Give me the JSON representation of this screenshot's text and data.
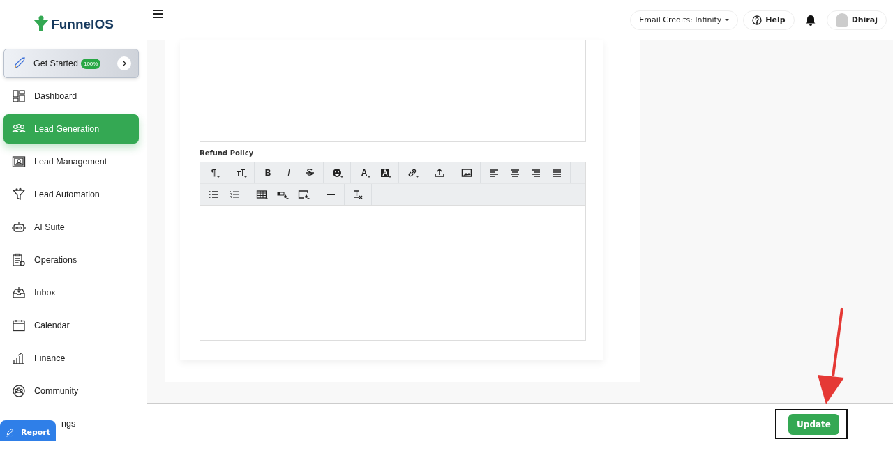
{
  "logo": {
    "text": "FunnelOS"
  },
  "get_started": {
    "label": "Get Started",
    "badge": "100%"
  },
  "sidebar": {
    "items": [
      {
        "label": "Dashboard",
        "kind": "dashboard",
        "selected": false
      },
      {
        "label": "Lead Generation",
        "kind": "people",
        "selected": true
      },
      {
        "label": "Lead Management",
        "kind": "contact",
        "selected": false
      },
      {
        "label": "Lead Automation",
        "kind": "funnel",
        "selected": false
      },
      {
        "label": "AI Suite",
        "kind": "robot",
        "selected": false
      },
      {
        "label": "Operations",
        "kind": "clipboard",
        "selected": false
      },
      {
        "label": "Inbox",
        "kind": "inbox",
        "selected": false
      },
      {
        "label": "Calendar",
        "kind": "calendar",
        "selected": false
      },
      {
        "label": "Finance",
        "kind": "chart",
        "selected": false
      },
      {
        "label": "Community",
        "kind": "community",
        "selected": false
      },
      {
        "label": "ngs",
        "kind": "hidden",
        "selected": false
      }
    ]
  },
  "report": {
    "label": "Report"
  },
  "header": {
    "credits": "Email Credits: Infinity",
    "help": "Help",
    "user": "Dhiraj"
  },
  "editor": {
    "label": "Refund Policy",
    "toolbar": [
      [
        [
          {
            "kind": "glyph",
            "glyph": "¶",
            "dropdown": true
          }
        ],
        [
          {
            "kind": "text-size",
            "dropdown": true
          }
        ],
        [
          {
            "kind": "glyph",
            "glyph": "B",
            "dropdown": false
          },
          {
            "kind": "glyph",
            "glyph": "I",
            "dropdown": false
          },
          {
            "kind": "strike",
            "dropdown": false
          }
        ],
        [
          {
            "kind": "emoji",
            "dropdown": true
          }
        ],
        [
          {
            "kind": "glyph",
            "glyph": "A",
            "dropdown": true
          },
          {
            "kind": "highlight",
            "dropdown": true
          }
        ],
        [
          {
            "kind": "link",
            "dropdown": true
          }
        ],
        [
          {
            "kind": "upload",
            "dropdown": false
          }
        ],
        [
          {
            "kind": "image",
            "dropdown": false
          }
        ],
        [
          {
            "kind": "align-left",
            "dropdown": false
          },
          {
            "kind": "align-center",
            "dropdown": false
          },
          {
            "kind": "align-right",
            "dropdown": false
          },
          {
            "kind": "justify",
            "dropdown": false
          }
        ]
      ],
      [
        [
          {
            "kind": "bullet-list",
            "dropdown": false
          },
          {
            "kind": "number-list",
            "dropdown": false
          }
        ],
        [
          {
            "kind": "table",
            "dropdown": true
          },
          {
            "kind": "cell-fill",
            "dropdown": true
          },
          {
            "kind": "box-fill",
            "dropdown": true
          }
        ],
        [
          {
            "kind": "rule",
            "dropdown": false
          }
        ],
        [
          {
            "kind": "clear-format",
            "dropdown": false
          }
        ]
      ]
    ]
  },
  "footer": {
    "button": "Update"
  }
}
